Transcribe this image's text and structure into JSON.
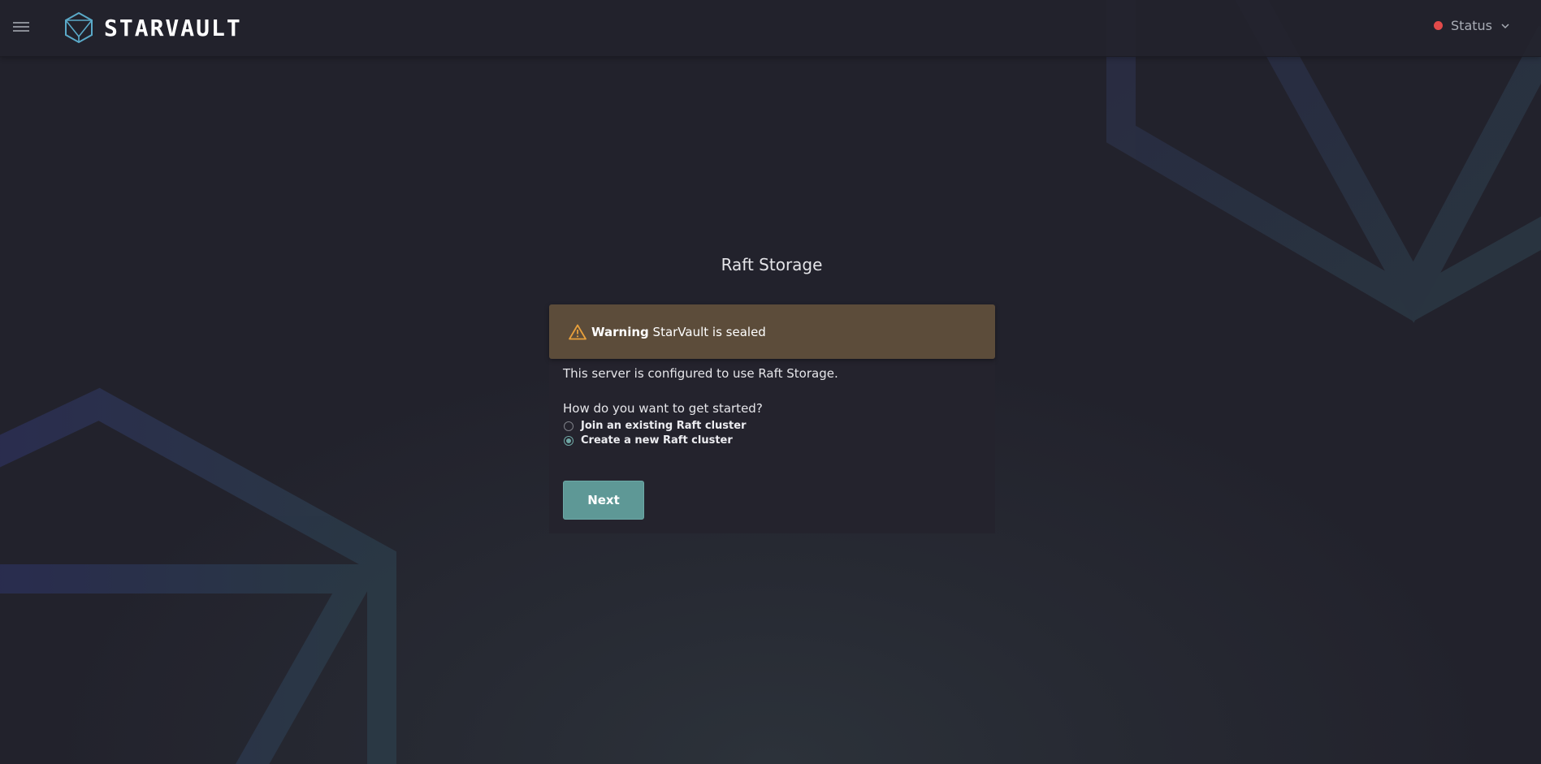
{
  "header": {
    "brand": "STARVAULT",
    "status_label": "Status",
    "status_color": "#e24a4a"
  },
  "page": {
    "title": "Raft Storage"
  },
  "warning": {
    "strong": "Warning",
    "message": " StarVault is sealed"
  },
  "form": {
    "info": "This server is configured to use Raft Storage.",
    "question": "How do you want to get started?",
    "options": [
      {
        "label": "Join an existing Raft cluster",
        "selected": false
      },
      {
        "label": "Create a new Raft cluster",
        "selected": true
      }
    ],
    "next_label": "Next"
  },
  "colors": {
    "accent": "#5e9896",
    "warning_bg": "#5c4c3a",
    "background": "#22222c"
  },
  "icons": {
    "menu": "hamburger-icon",
    "logo": "hexagon-logo-icon",
    "warning": "warning-triangle-icon",
    "status_chevron": "chevron-down-icon"
  }
}
